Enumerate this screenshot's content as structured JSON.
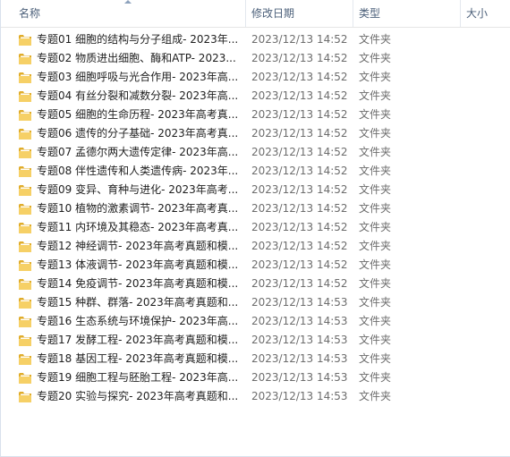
{
  "header": {
    "name": "名称",
    "date_modified": "修改日期",
    "type": "类型",
    "size": "大小"
  },
  "files": [
    {
      "name": "专题01 细胞的结构与分子组成- 2023年...",
      "date": "2023/12/13 14:52",
      "type": "文件夹",
      "icon": "folder-icon"
    },
    {
      "name": "专题02 物质进出细胞、酶和ATP- 2023...",
      "date": "2023/12/13 14:52",
      "type": "文件夹",
      "icon": "folder-icon"
    },
    {
      "name": "专题03 细胞呼吸与光合作用- 2023年高...",
      "date": "2023/12/13 14:52",
      "type": "文件夹",
      "icon": "folder-icon"
    },
    {
      "name": "专题04 有丝分裂和减数分裂- 2023年高...",
      "date": "2023/12/13 14:52",
      "type": "文件夹",
      "icon": "folder-icon"
    },
    {
      "name": "专题05 细胞的生命历程- 2023年高考真...",
      "date": "2023/12/13 14:52",
      "type": "文件夹",
      "icon": "folder-icon"
    },
    {
      "name": "专题06 遗传的分子基础- 2023年高考真...",
      "date": "2023/12/13 14:52",
      "type": "文件夹",
      "icon": "folder-icon"
    },
    {
      "name": "专题07 孟德尔两大遗传定律- 2023年高...",
      "date": "2023/12/13 14:52",
      "type": "文件夹",
      "icon": "folder-icon"
    },
    {
      "name": "专题08 伴性遗传和人类遗传病- 2023年...",
      "date": "2023/12/13 14:52",
      "type": "文件夹",
      "icon": "folder-icon"
    },
    {
      "name": "专题09 变异、育种与进化- 2023年高考...",
      "date": "2023/12/13 14:52",
      "type": "文件夹",
      "icon": "folder-icon"
    },
    {
      "name": "专题10 植物的激素调节- 2023年高考真...",
      "date": "2023/12/13 14:52",
      "type": "文件夹",
      "icon": "folder-icon"
    },
    {
      "name": "专题11 内环境及其稳态- 2023年高考真...",
      "date": "2023/12/13 14:52",
      "type": "文件夹",
      "icon": "folder-icon"
    },
    {
      "name": "专题12 神经调节- 2023年高考真题和模...",
      "date": "2023/12/13 14:52",
      "type": "文件夹",
      "icon": "folder-icon"
    },
    {
      "name": "专题13 体液调节- 2023年高考真题和模...",
      "date": "2023/12/13 14:52",
      "type": "文件夹",
      "icon": "folder-icon"
    },
    {
      "name": "专题14 免疫调节- 2023年高考真题和模...",
      "date": "2023/12/13 14:52",
      "type": "文件夹",
      "icon": "folder-icon"
    },
    {
      "name": "专题15 种群、群落- 2023年高考真题和...",
      "date": "2023/12/13 14:53",
      "type": "文件夹",
      "icon": "folder-icon"
    },
    {
      "name": "专题16 生态系统与环境保护- 2023年高...",
      "date": "2023/12/13 14:53",
      "type": "文件夹",
      "icon": "folder-icon"
    },
    {
      "name": "专题17 发酵工程- 2023年高考真题和模...",
      "date": "2023/12/13 14:53",
      "type": "文件夹",
      "icon": "folder-icon"
    },
    {
      "name": "专题18 基因工程- 2023年高考真题和模...",
      "date": "2023/12/13 14:53",
      "type": "文件夹",
      "icon": "folder-icon"
    },
    {
      "name": "专题19 细胞工程与胚胎工程- 2023年高...",
      "date": "2023/12/13 14:53",
      "type": "文件夹",
      "icon": "folder-icon"
    },
    {
      "name": "专题20 实验与探究- 2023年高考真题和...",
      "date": "2023/12/13 14:53",
      "type": "文件夹",
      "icon": "folder-icon"
    }
  ],
  "colors": {
    "folder_back": "#e0ad2c",
    "folder_front": "#f6d066",
    "folder_paper": "#ffffff"
  }
}
